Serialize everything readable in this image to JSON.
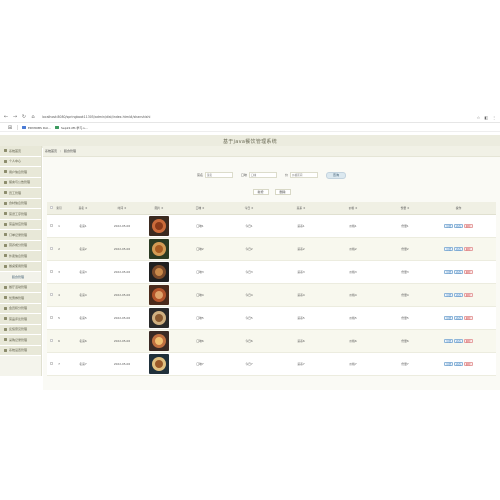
{
  "browser": {
    "url": "localhost:8080/springboot11305/admin/dist/index.html#/shanshishi",
    "bookmarks": [
      "EDMIOBS DAI...",
      "Sep22-Mt-学习-L..."
    ]
  },
  "app": {
    "title": "基于java餐饮管理系统",
    "user_label": "管理员 admin",
    "logout": "退出登录"
  },
  "sidebar": {
    "items": [
      {
        "label": "系统首页",
        "active": false,
        "sub": false
      },
      {
        "label": "个人中心",
        "active": false,
        "sub": false
      },
      {
        "label": "用户信息管理",
        "active": false,
        "sub": false
      },
      {
        "label": "留言与公告管理",
        "active": false,
        "sub": false
      },
      {
        "label": "员工管理",
        "active": false,
        "sub": false
      },
      {
        "label": "食材信息管理",
        "active": false,
        "sub": false
      },
      {
        "label": "菜谱工序管理",
        "active": false,
        "sub": false
      },
      {
        "label": "菜品供应管理",
        "active": false,
        "sub": false
      },
      {
        "label": "订单记录管理",
        "active": false,
        "sub": false
      },
      {
        "label": "营养成分管理",
        "active": false,
        "sub": false
      },
      {
        "label": "外卖信息管理",
        "active": false,
        "sub": false
      },
      {
        "label": "餐桌使用管理",
        "active": false,
        "sub": false
      },
      {
        "label": "膳食管理",
        "active": true,
        "sub": true
      },
      {
        "label": "餐厅活动管理",
        "active": false,
        "sub": false
      },
      {
        "label": "优惠券管理",
        "active": false,
        "sub": false
      },
      {
        "label": "会员积分管理",
        "active": false,
        "sub": false
      },
      {
        "label": "菜品评论管理",
        "active": false,
        "sub": false
      },
      {
        "label": "反馈意见管理",
        "active": false,
        "sub": false
      },
      {
        "label": "采购记录管理",
        "active": false,
        "sub": false
      },
      {
        "label": "系统设置管理",
        "active": false,
        "sub": false
      }
    ]
  },
  "breadcrumb": {
    "home": "系统首页",
    "current": "膳食管理"
  },
  "search": {
    "label1": "菜名",
    "placeholder1": "菜名",
    "label2": "口味",
    "placeholder2": "口味",
    "label3": "价",
    "placeholder3": "价格区间",
    "button": "查询"
  },
  "actions": {
    "add": "新增",
    "delete": "删除"
  },
  "table": {
    "headers": [
      "",
      "索引",
      "菜名 ≑",
      "时间 ≑",
      "图片 ≑",
      "口味 ≑",
      "今日 ≑",
      "菜系 ≑",
      "价格 ≑",
      "份量 ≑",
      "操作"
    ],
    "rows": [
      {
        "index": "1",
        "name": "名菜1",
        "time": "2022-05-06",
        "taste": "口味1",
        "today": "今日1",
        "cuisine": "菜系1",
        "price": "价格1",
        "portion": "份量1"
      },
      {
        "index": "2",
        "name": "名菜2",
        "time": "2022-05-06",
        "taste": "口味2",
        "today": "今日2",
        "cuisine": "菜系2",
        "price": "价格2",
        "portion": "份量2"
      },
      {
        "index": "3",
        "name": "名菜3",
        "time": "2022-05-06",
        "taste": "口味3",
        "today": "今日3",
        "cuisine": "菜系3",
        "price": "价格3",
        "portion": "份量3"
      },
      {
        "index": "4",
        "name": "名菜4",
        "time": "2022-05-06",
        "taste": "口味4",
        "today": "今日4",
        "cuisine": "菜系4",
        "price": "价格4",
        "portion": "份量4"
      },
      {
        "index": "5",
        "name": "名菜5",
        "time": "2022-05-06",
        "taste": "口味5",
        "today": "今日5",
        "cuisine": "菜系5",
        "price": "价格5",
        "portion": "份量5"
      },
      {
        "index": "6",
        "name": "名菜6",
        "time": "2022-05-06",
        "taste": "口味6",
        "today": "今日6",
        "cuisine": "菜系6",
        "price": "价格6",
        "portion": "份量6"
      },
      {
        "index": "7",
        "name": "名菜7",
        "time": "2022-05-06",
        "taste": "口味7",
        "today": "今日7",
        "cuisine": "菜系7",
        "price": "价格7",
        "portion": "份量7"
      }
    ],
    "ops": {
      "view": "详情",
      "edit": "修改",
      "del": "删除"
    }
  },
  "thumb_colors": [
    [
      "#3b2a20",
      "#c96a3a",
      "#8a3a1a"
    ],
    [
      "#2b3a22",
      "#d39b54",
      "#a85c22"
    ],
    [
      "#202020",
      "#7a4a2a",
      "#c98a4a"
    ],
    [
      "#4a2a1a",
      "#b3542a",
      "#e0a36a"
    ],
    [
      "#2a2a2a",
      "#d0b080",
      "#8a5a30"
    ],
    [
      "#3a2a24",
      "#c07040",
      "#f0c070"
    ],
    [
      "#20303a",
      "#e0c080",
      "#9a5a2a"
    ]
  ]
}
